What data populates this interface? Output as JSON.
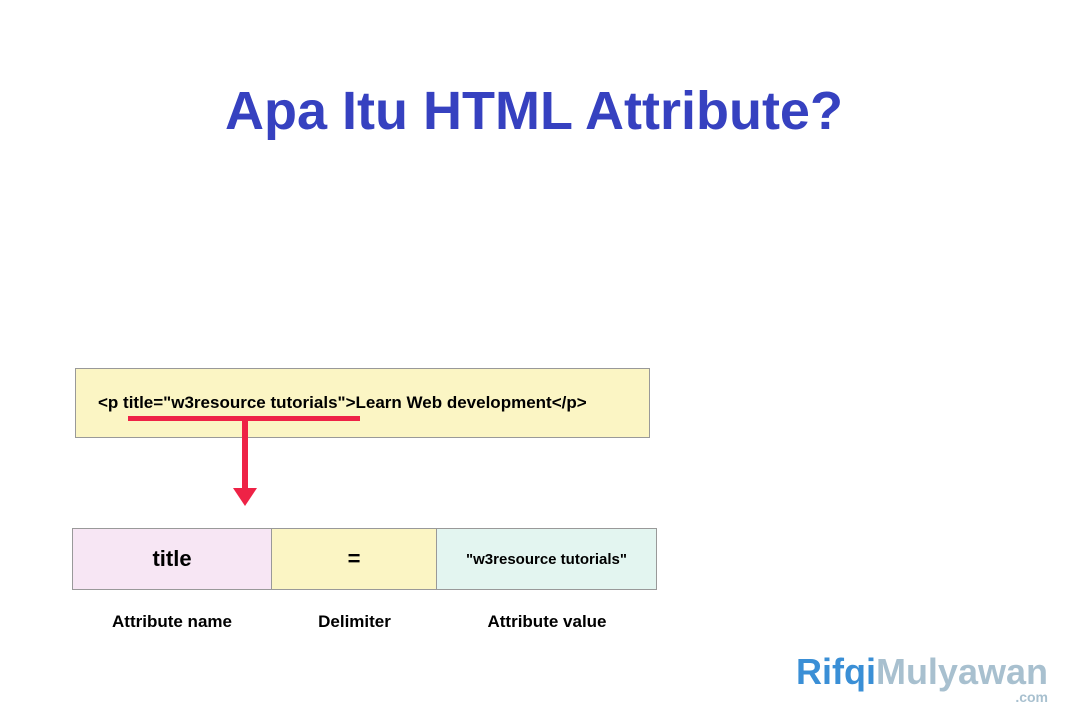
{
  "title": "Apa Itu HTML Attribute?",
  "codeExample": "<p title=\"w3resource tutorials\">Learn Web development</p>",
  "parts": {
    "name": "title",
    "delimiter": "=",
    "value": "\"w3resource tutorials\""
  },
  "labels": {
    "name": "Attribute name",
    "delimiter": "Delimiter",
    "value": "Attribute value"
  },
  "watermark": {
    "first": "Rifqi",
    "last": "Mulyawan",
    "suffix": ".com"
  }
}
